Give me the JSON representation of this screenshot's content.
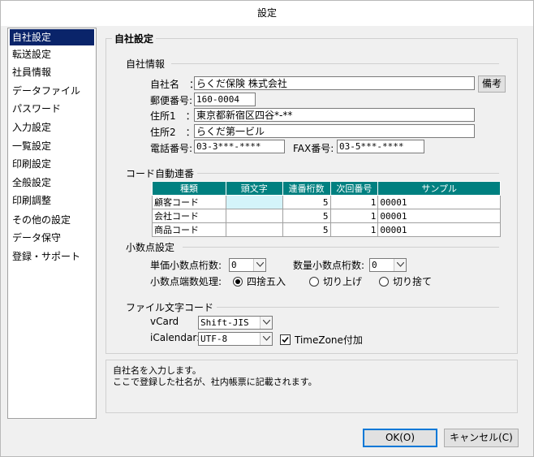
{
  "window": {
    "title": "設定"
  },
  "sidebar": {
    "items": [
      {
        "label": "自社設定",
        "selected": true
      },
      {
        "label": "転送設定"
      },
      {
        "label": "社員情報"
      },
      {
        "label": "データファイル"
      },
      {
        "label": "パスワード"
      },
      {
        "label": "入力設定"
      },
      {
        "label": "一覧設定"
      },
      {
        "label": "印刷設定"
      },
      {
        "label": "全般設定"
      },
      {
        "label": "印刷調整"
      },
      {
        "label": "その他の設定"
      },
      {
        "label": "データ保守"
      },
      {
        "label": "登録・サポート"
      }
    ]
  },
  "main": {
    "group_title": "自社設定",
    "company": {
      "section_label": "自社情報",
      "name_label": "自社名　：",
      "name_value": "らくだ保険 株式会社",
      "notes_button": "備考",
      "zip_label": "郵便番号:",
      "zip_value": "160-0004",
      "addr1_label": "住所1　：",
      "addr1_value": "東京都新宿区四谷*-**",
      "addr2_label": "住所2　：",
      "addr2_value": "らくだ第一ビル",
      "phone_label": "電話番号:",
      "phone_value": "03-3***-****",
      "fax_label": "FAX番号:",
      "fax_value": "03-5***-****"
    },
    "code_numbering": {
      "section_label": "コード自動連番",
      "headers": [
        "種類",
        "頭文字",
        "連番桁数",
        "次回番号",
        "サンプル"
      ],
      "rows": [
        {
          "kind": "顧客コード",
          "prefix": "",
          "digits": "5",
          "next": "1",
          "sample": "00001"
        },
        {
          "kind": "会社コード",
          "prefix": "",
          "digits": "5",
          "next": "1",
          "sample": "00001"
        },
        {
          "kind": "商品コード",
          "prefix": "",
          "digits": "5",
          "next": "1",
          "sample": "00001"
        }
      ]
    },
    "decimal": {
      "section_label": "小数点設定",
      "unit_price_label": "単価小数点桁数:",
      "unit_price_value": "0",
      "qty_label": "数量小数点桁数:",
      "qty_value": "0",
      "rounding_label": "小数点端数処理:",
      "options": [
        "四捨五入",
        "切り上げ",
        "切り捨て"
      ],
      "selected_option": "四捨五入"
    },
    "encoding": {
      "section_label": "ファイル文字コード",
      "vcard_label": "vCard",
      "vcard_value": "Shift-JIS",
      "ical_label": "iCalendar:",
      "ical_value": "UTF-8",
      "timezone_label": "TimeZone付加",
      "timezone_checked": true
    },
    "description": {
      "line1": "自社名を入力します。",
      "line2": "ここで登録した社名が、社内帳票に記載されます。"
    }
  },
  "footer": {
    "ok_label": "OK(O)",
    "cancel_label": "キャンセル(C)"
  },
  "colors": {
    "selection": "#0a246a",
    "grid_header": "#008080",
    "prefix_cell": "#d4f4fa"
  }
}
